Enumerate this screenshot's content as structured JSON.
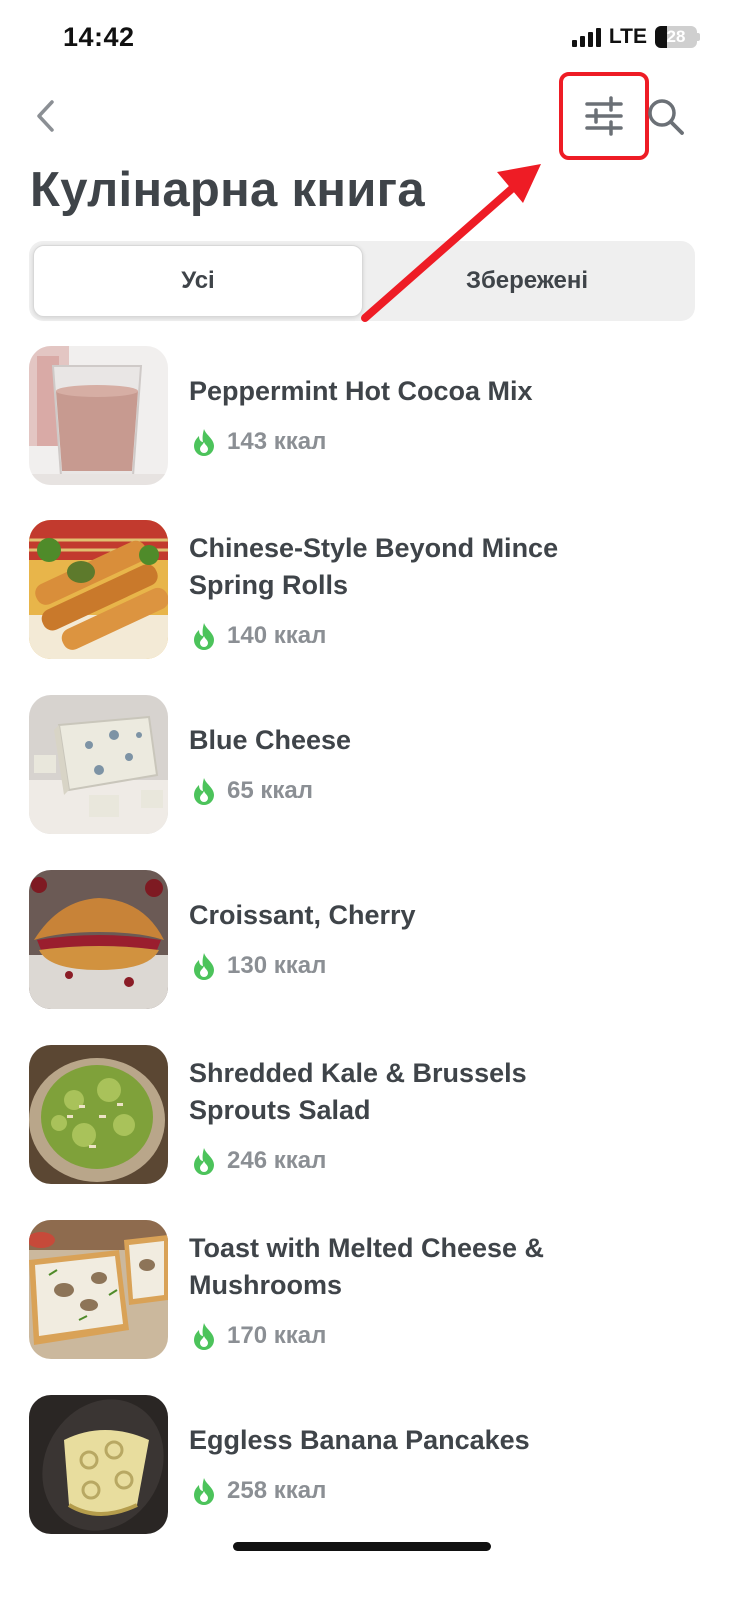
{
  "status": {
    "time": "14:42",
    "network": "LTE",
    "battery": "28",
    "battery_level_percent": 28
  },
  "header": {
    "back_icon": "chevron-left-icon",
    "filter_icon": "sliders-icon",
    "search_icon": "search-icon",
    "title": "Кулінарна книга"
  },
  "tabs": [
    {
      "label": "Усі",
      "active": true
    },
    {
      "label": "Збережені",
      "active": false
    }
  ],
  "recipes": [
    {
      "name": "Peppermint Hot Cocoa Mix",
      "kcal": "143 ккал"
    },
    {
      "name": "Chinese-Style Beyond Mince Spring Rolls",
      "kcal": "140 ккал"
    },
    {
      "name": "Blue Cheese",
      "kcal": "65 ккал"
    },
    {
      "name": "Croissant, Cherry",
      "kcal": "130 ккал"
    },
    {
      "name": "Shredded Kale & Brussels Sprouts Salad",
      "kcal": "246 ккал"
    },
    {
      "name": "Toast with Melted Cheese & Mushrooms",
      "kcal": "170 ккал"
    },
    {
      "name": "Eggless Banana Pancakes",
      "kcal": "258 ккал"
    }
  ],
  "colors": {
    "accent_red": "#ee1c25",
    "kcal_green": "#4cc35b",
    "text": "#3f4449",
    "muted": "#8b8f94"
  }
}
